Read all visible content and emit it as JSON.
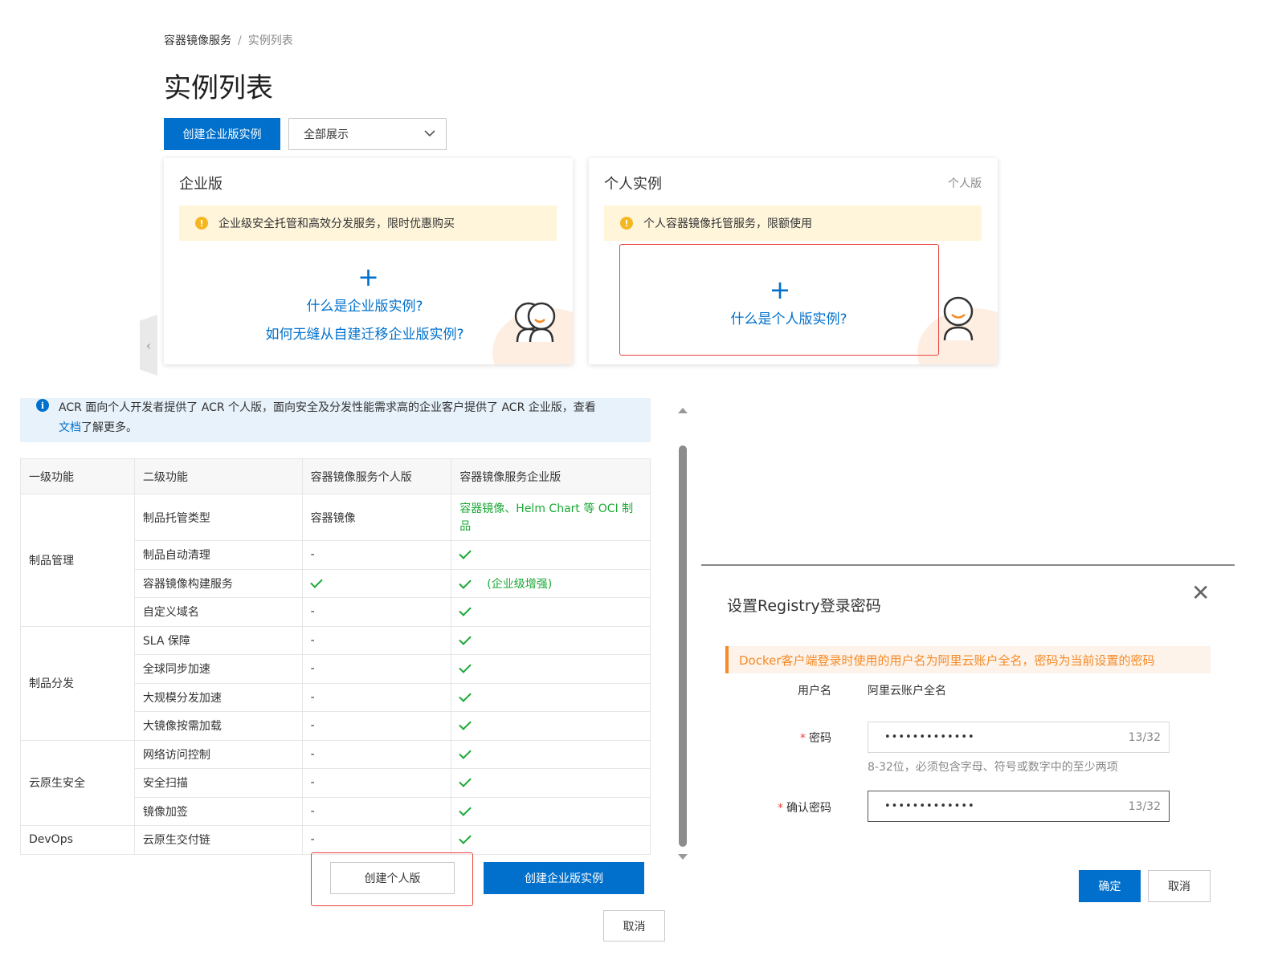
{
  "breadcrumb": {
    "root": "容器镜像服务",
    "separator": "/",
    "current": "实例列表"
  },
  "page_title": "实例列表",
  "toolbar": {
    "create_enterprise_label": "创建企业版实例",
    "filter_value": "全部展示"
  },
  "enterprise_card": {
    "title": "企业版",
    "alert": "企业级安全托管和高效分发服务，限时优惠购买",
    "plus": "+",
    "link1": "什么是企业版实例?",
    "link2": "如何无缝从自建迁移企业版实例?"
  },
  "personal_card": {
    "title": "个人实例",
    "tag": "个人版",
    "alert": "个人容器镜像托管服务，限额使用",
    "plus": "+",
    "link": "什么是个人版实例?"
  },
  "info_bar": {
    "text": "ACR 面向个人开发者提供了 ACR 个人版，面向安全及分发性能需求高的企业客户提供了 ACR 企业版，查看",
    "link": "文档",
    "suffix": "了解更多。"
  },
  "table": {
    "headers": [
      "一级功能",
      "二级功能",
      "容器镜像服务个人版",
      "容器镜像服务企业版"
    ],
    "groups": [
      "制品管理",
      "制品分发",
      "云原生安全",
      "DevOps"
    ],
    "rows": [
      {
        "feature": "制品托管类型",
        "personal": "容器镜像",
        "enterprise": "容器镜像、Helm Chart 等 OCI 制品"
      },
      {
        "feature": "制品自动清理",
        "personal": "-"
      },
      {
        "feature": "容器镜像构建服务",
        "enterprise_note": "(企业级增强)"
      },
      {
        "feature": "自定义域名",
        "personal": "-"
      },
      {
        "feature": "SLA 保障",
        "personal": "-"
      },
      {
        "feature": "全球同步加速",
        "personal": "-"
      },
      {
        "feature": "大规模分发加速",
        "personal": "-"
      },
      {
        "feature": "大镜像按需加载",
        "personal": "-"
      },
      {
        "feature": "网络访问控制",
        "personal": "-"
      },
      {
        "feature": "安全扫描",
        "personal": "-"
      },
      {
        "feature": "镜像加签",
        "personal": "-"
      },
      {
        "feature": "云原生交付链",
        "personal": "-"
      }
    ]
  },
  "dialog_buttons": {
    "create_personal": "创建个人版",
    "create_enterprise": "创建企业版实例",
    "cancel": "取消"
  },
  "modal": {
    "title": "设置Registry登录密码",
    "alert": "Docker客户端登录时使用的用户名为阿里云账户全名，密码为当前设置的密码",
    "username_label": "用户名",
    "username_value": "阿里云账户全名",
    "required_mark": "*",
    "password_label": "密码",
    "password_value": "•••••••••••••",
    "password_count": "13/32",
    "password_help": "8-32位，必须包含字母、符号或数字中的至少两项",
    "confirm_label": "确认密码",
    "confirm_value": "•••••••••••••",
    "confirm_count": "13/32",
    "ok": "确定",
    "cancel": "取消"
  },
  "colors": {
    "primary": "#0070cc",
    "success": "#1aa935",
    "warning": "#f58a26",
    "highlight": "#e9433e"
  }
}
